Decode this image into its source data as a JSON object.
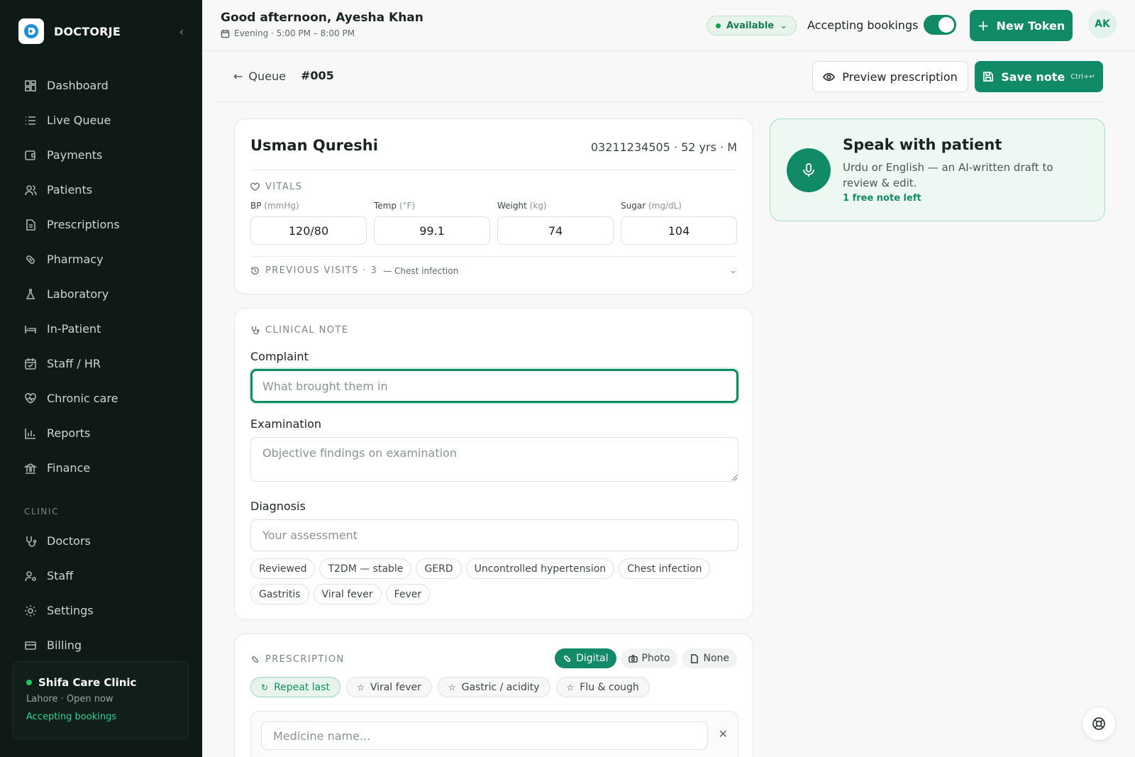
{
  "app": {
    "brand": "DOCTORJE"
  },
  "sidebar": {
    "items": [
      {
        "label": "Dashboard",
        "icon": "dashboard-icon"
      },
      {
        "label": "Live Queue",
        "icon": "list-icon"
      },
      {
        "label": "Payments",
        "icon": "wallet-icon"
      },
      {
        "label": "Patients",
        "icon": "users-icon"
      },
      {
        "label": "Prescriptions",
        "icon": "file-icon"
      },
      {
        "label": "Pharmacy",
        "icon": "pill-icon"
      },
      {
        "label": "Laboratory",
        "icon": "flask-icon"
      },
      {
        "label": "In-Patient",
        "icon": "bed-icon"
      },
      {
        "label": "Staff / HR",
        "icon": "calendar-icon"
      },
      {
        "label": "Chronic care",
        "icon": "heart-pulse-icon"
      },
      {
        "label": "Reports",
        "icon": "bar-chart-icon"
      },
      {
        "label": "Finance",
        "icon": "bank-icon"
      }
    ],
    "section_clinic": "CLINIC",
    "clinic_items": [
      {
        "label": "Doctors",
        "icon": "stethoscope-icon"
      },
      {
        "label": "Staff",
        "icon": "user-cog-icon"
      },
      {
        "label": "Settings",
        "icon": "sun-icon"
      },
      {
        "label": "Billing",
        "icon": "card-icon"
      }
    ],
    "clinic_card": {
      "name": "Shifa Care Clinic",
      "sub": "Lahore · Open now",
      "status": "Accepting bookings"
    }
  },
  "topbar": {
    "greeting": "Good afternoon, Ayesha Khan",
    "shift": "Evening · 5:00 PM – 8:00 PM",
    "availability": "Available",
    "accepting_label": "Accepting bookings",
    "accepting_on": true,
    "new_token": "New Token",
    "avatar_initials": "AK"
  },
  "subheader": {
    "back_label": "Queue",
    "queue_number": "#005",
    "preview_label": "Preview prescription",
    "save_label": "Save note",
    "save_shortcut": "Ctrl+↵"
  },
  "patient": {
    "name": "Usman Qureshi",
    "meta": "03211234505 · 52 yrs · M",
    "vitals_title": "VITALS",
    "vitals": [
      {
        "label": "BP",
        "unit": "(mmHg)",
        "value": "120/80"
      },
      {
        "label": "Temp",
        "unit": "(°F)",
        "value": "99.1"
      },
      {
        "label": "Weight",
        "unit": "(kg)",
        "value": "74"
      },
      {
        "label": "Sugar",
        "unit": "(mg/dL)",
        "value": "104"
      }
    ],
    "previous_visits": "PREVIOUS VISITS · 3",
    "previous_visits_note": "— Chest infection"
  },
  "clinical_note": {
    "title": "CLINICAL NOTE",
    "complaint_label": "Complaint",
    "complaint_placeholder": "What brought them in",
    "examination_label": "Examination",
    "examination_placeholder": "Objective findings on examination",
    "diagnosis_label": "Diagnosis",
    "diagnosis_placeholder": "Your assessment",
    "diagnosis_chips": [
      "Reviewed",
      "T2DM — stable",
      "GERD",
      "Uncontrolled hypertension",
      "Chest infection",
      "Gastritis",
      "Viral fever",
      "Fever"
    ]
  },
  "prescription": {
    "title": "PRESCRIPTION",
    "modes": [
      "Digital",
      "Photo",
      "None"
    ],
    "active_mode": "Digital",
    "repeat_last": "Repeat last",
    "templates": [
      "Viral fever",
      "Gastric / acidity",
      "Flu & cough"
    ],
    "medicine_placeholder": "Medicine name..."
  },
  "speak": {
    "title": "Speak with patient",
    "description": "Urdu or English — an AI-written draft to review & edit.",
    "free_note": "1 free note left"
  },
  "colors": {
    "accent": "#118a67",
    "sidebar_bg": "#0f1915",
    "status_green": "#22c55e"
  }
}
